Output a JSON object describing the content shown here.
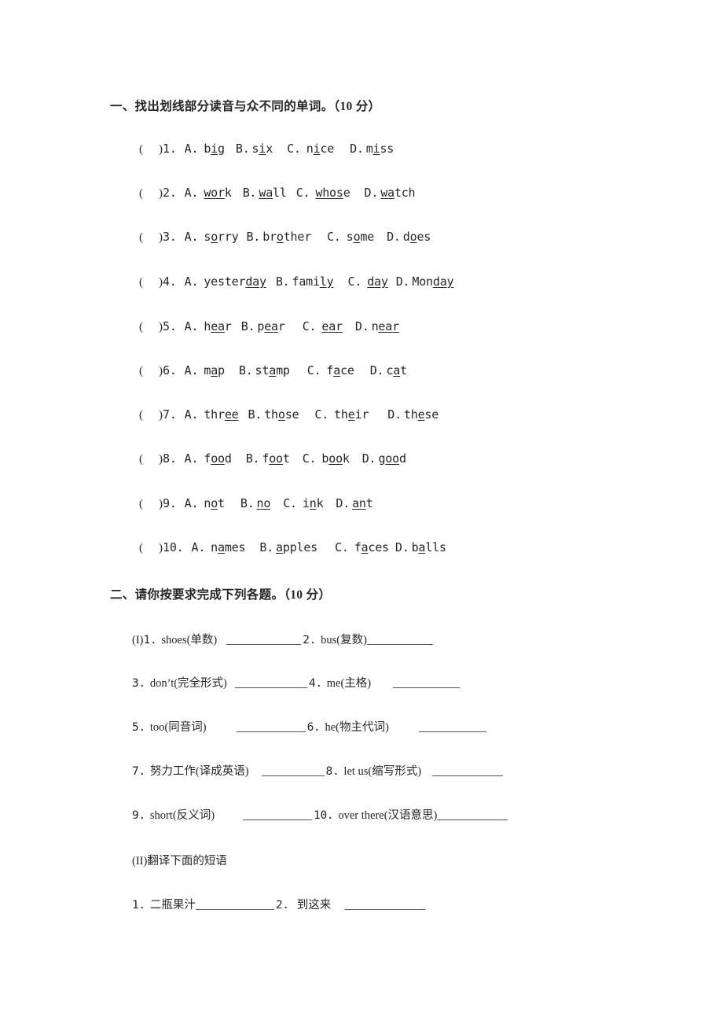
{
  "document": {
    "background_color": "#ffffff",
    "text_color": "#262626"
  },
  "section1": {
    "heading": "一、找出划线部分读音与众不同的单词。（10 分）",
    "bracket_open": "(",
    "bracket_close": ")",
    "questions": [
      {
        "number": "1.",
        "options": [
          {
            "letter": "A.",
            "pre": "b",
            "underlined": "i",
            "post": "g"
          },
          {
            "letter": "B.",
            "pre": "s",
            "underlined": "i",
            "post": "x"
          },
          {
            "letter": "C.",
            "pre": "n",
            "underlined": "i",
            "post": "ce"
          },
          {
            "letter": "D.",
            "pre": "m",
            "underlined": "i",
            "post": "ss"
          }
        ]
      },
      {
        "number": "2.",
        "options": [
          {
            "letter": "A.",
            "pre": "",
            "underlined": "wor",
            "post": "k"
          },
          {
            "letter": "B.",
            "pre": "",
            "underlined": "wa",
            "post": "ll"
          },
          {
            "letter": "C.",
            "pre": "",
            "underlined": "whos",
            "post": "e"
          },
          {
            "letter": "D.",
            "pre": "",
            "underlined": "wa",
            "post": "tch"
          }
        ]
      },
      {
        "number": "3.",
        "options": [
          {
            "letter": "A.",
            "pre": "s",
            "underlined": "o",
            "post": "rry"
          },
          {
            "letter": "B.",
            "pre": "br",
            "underlined": "o",
            "post": "ther"
          },
          {
            "letter": "C.",
            "pre": "s",
            "underlined": "o",
            "post": "me"
          },
          {
            "letter": "D.",
            "pre": "d",
            "underlined": "o",
            "post": "es"
          }
        ]
      },
      {
        "number": "4.",
        "options": [
          {
            "letter": "A.",
            "pre": "yester",
            "underlined": "day",
            "post": ""
          },
          {
            "letter": "B.",
            "pre": "fami",
            "underlined": "ly",
            "post": ""
          },
          {
            "letter": "C.",
            "pre": "",
            "underlined": "day",
            "post": ""
          },
          {
            "letter": "D.",
            "pre": "Mon",
            "underlined": "day",
            "post": ""
          }
        ]
      },
      {
        "number": "5.",
        "options": [
          {
            "letter": "A.",
            "pre": "h",
            "underlined": "ea",
            "post": "r"
          },
          {
            "letter": "B.",
            "pre": "p",
            "underlined": "ea",
            "post": "r"
          },
          {
            "letter": "C.",
            "pre": "",
            "underlined": "ear",
            "post": ""
          },
          {
            "letter": "D.",
            "pre": "n",
            "underlined": "ear",
            "post": ""
          }
        ]
      },
      {
        "number": "6.",
        "options": [
          {
            "letter": "A.",
            "pre": "m",
            "underlined": "a",
            "post": "p"
          },
          {
            "letter": "B.",
            "pre": "st",
            "underlined": "a",
            "post": "mp"
          },
          {
            "letter": "C.",
            "pre": "f",
            "underlined": "a",
            "post": "ce"
          },
          {
            "letter": "D.",
            "pre": "c",
            "underlined": "a",
            "post": "t"
          }
        ]
      },
      {
        "number": "7.",
        "options": [
          {
            "letter": "A.",
            "pre": "thr",
            "underlined": "ee",
            "post": ""
          },
          {
            "letter": "B.",
            "pre": "th",
            "underlined": "o",
            "post": "se"
          },
          {
            "letter": "C.",
            "pre": "th",
            "underlined": "e",
            "post": "ir"
          },
          {
            "letter": "D.",
            "pre": "th",
            "underlined": "e",
            "post": "se"
          }
        ]
      },
      {
        "number": "8.",
        "options": [
          {
            "letter": "A.",
            "pre": "f",
            "underlined": "oo",
            "post": "d"
          },
          {
            "letter": "B.",
            "pre": "f",
            "underlined": "oo",
            "post": "t"
          },
          {
            "letter": "C.",
            "pre": "b",
            "underlined": "oo",
            "post": "k"
          },
          {
            "letter": "D.",
            "pre": "g",
            "underlined": "oo",
            "post": "d"
          }
        ]
      },
      {
        "number": "9.",
        "options": [
          {
            "letter": "A.",
            "pre": "n",
            "underlined": "o",
            "post": "t"
          },
          {
            "letter": "B.",
            "pre": "",
            "underlined": "no",
            "post": ""
          },
          {
            "letter": "C.",
            "pre": "i",
            "underlined": "n",
            "post": "k"
          },
          {
            "letter": "D.",
            "pre": "",
            "underlined": "an",
            "post": "t"
          }
        ]
      },
      {
        "number": "10.",
        "options": [
          {
            "letter": "A.",
            "pre": "n",
            "underlined": "a",
            "post": "mes"
          },
          {
            "letter": "B.",
            "pre": "",
            "underlined": "a",
            "post": "pples"
          },
          {
            "letter": "C.",
            "pre": "f",
            "underlined": "a",
            "post": "ces"
          },
          {
            "letter": "D.",
            "pre": "b",
            "underlined": "a",
            "post": "lls"
          }
        ]
      }
    ]
  },
  "section2": {
    "heading": "二、请你按要求完成下列各题。（10 分）",
    "part1_prefix": "(I)",
    "items": [
      {
        "number": "1.",
        "text": "shoes(单数)"
      },
      {
        "number": "2.",
        "text": "bus(复数)"
      },
      {
        "number": "3.",
        "text": "don’t(完全形式)"
      },
      {
        "number": "4.",
        "text": "me(主格)"
      },
      {
        "number": "5.",
        "text": "too(同音词)"
      },
      {
        "number": "6.",
        "text": "he(物主代词)"
      },
      {
        "number": "7.",
        "text": "努力工作(译成英语)"
      },
      {
        "number": "8.",
        "text": "let us(缩写形式)"
      },
      {
        "number": "9.",
        "text": "short(反义词)"
      },
      {
        "number": "10.",
        "text": "over there(汉语意思)"
      }
    ],
    "part2_heading": "(II)翻译下面的短语",
    "part2_items": [
      {
        "number": "1.",
        "text": "二瓶果汁"
      },
      {
        "number": "2.",
        "text": "到这来"
      }
    ]
  }
}
